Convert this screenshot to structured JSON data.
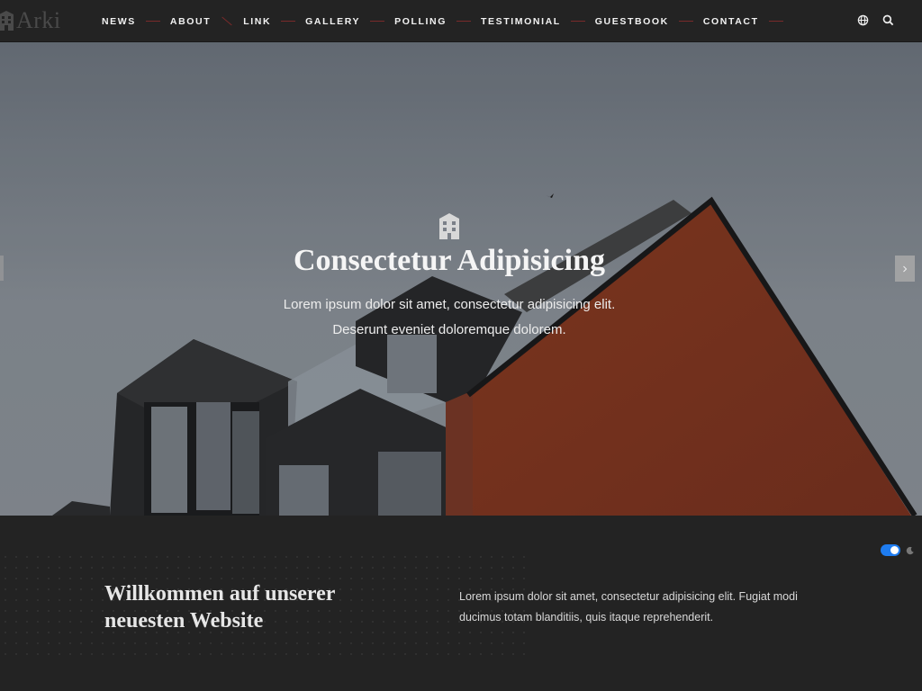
{
  "brand": {
    "name": "Arki"
  },
  "nav": {
    "items": [
      {
        "label": "NEWS"
      },
      {
        "label": "ABOUT"
      },
      {
        "label": "LINK"
      },
      {
        "label": "GALLERY"
      },
      {
        "label": "POLLING"
      },
      {
        "label": "TESTIMONIAL"
      },
      {
        "label": "GUESTBOOK"
      },
      {
        "label": "CONTACT"
      }
    ]
  },
  "header_icons": [
    "globe-icon",
    "search-icon"
  ],
  "hero": {
    "icon": "building-icon",
    "title": "Consectetur Adipisicing",
    "text": "Lorem ipsum dolor sit amet, consectetur adipisicing elit. Deserunt eveniet doloremque dolorem."
  },
  "welcome": {
    "title": "Willkommen auf unserer neuesten Website",
    "text": "Lorem ipsum dolor sit amet, consectetur adipisicing elit. Fugiat modi ducimus totam blanditiis, quis itaque reprehenderit."
  },
  "theme": {
    "dark_mode_enabled": true,
    "accent": "#1e7cf0"
  }
}
